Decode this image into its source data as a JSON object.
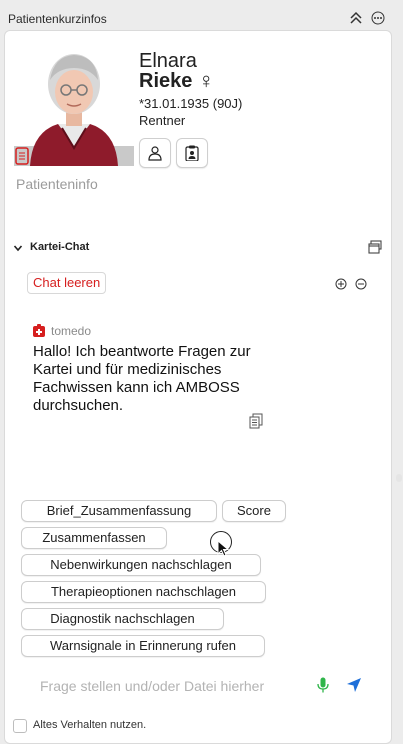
{
  "window": {
    "title": "Patientenkurzinfos",
    "collapse_icon": "double-chevron-up-icon",
    "more_icon": "ellipsis-circle-icon"
  },
  "patient": {
    "first_name": "Elnara",
    "last_name": "Rieke",
    "gender_symbol": "♀",
    "dob": "*31.01.1935 (90J)",
    "occupation": "Rentner",
    "buttons": [
      {
        "icon": "person-icon"
      },
      {
        "icon": "clipboard-person-icon"
      }
    ],
    "info_placeholder": "Patienteninfo"
  },
  "chat": {
    "section_title": "Kartei-Chat",
    "clear_label": "Chat leeren",
    "sender": "tomedo",
    "message": "Hallo! Ich beantworte Fragen zur Kartei und für medizinisches Fachwissen kann ich AMBOSS durchsuchen.",
    "suggestions": [
      "Brief_Zusammenfassung",
      "Score",
      "Zusammenfassen",
      "Nebenwirkungen nachschlagen",
      "Therapieoptionen nachschlagen",
      "Diagnostik nachschlagen",
      "Warnsignale in Erinnerung rufen"
    ],
    "input_placeholder": "Frage stellen und/oder Datei hierher",
    "legacy_checkbox_label": "Altes Verhalten nutzen.",
    "legacy_checked": false
  },
  "colors": {
    "accent_red": "#d61f1f",
    "mic_green": "#2fb54a",
    "send_blue": "#1e6fd9"
  }
}
